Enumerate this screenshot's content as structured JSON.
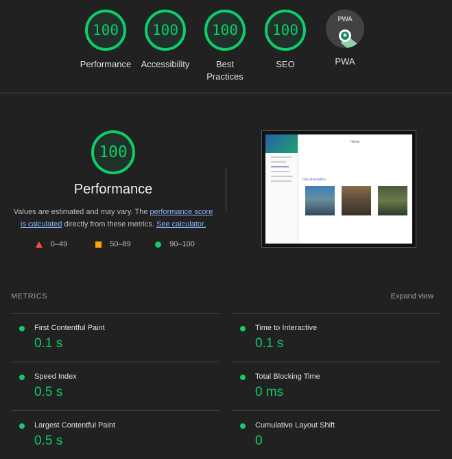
{
  "gauges": [
    {
      "label": "Performance",
      "score": "100"
    },
    {
      "label": "Accessibility",
      "score": "100"
    },
    {
      "label": "Best Practices",
      "score": "100"
    },
    {
      "label": "SEO",
      "score": "100"
    },
    {
      "label": "PWA",
      "badge_text": "PWA",
      "icon": "pwa-badge-icon"
    }
  ],
  "performance": {
    "score": "100",
    "title": "Performance",
    "desc_prefix": "Values are estimated and may vary. The ",
    "link_score": "performance score is calculated",
    "desc_middle": " directly from these metrics. ",
    "link_calculator": "See calculator.",
    "legend": [
      {
        "shape": "triangle",
        "range": "0–49",
        "color": "#ff4e42"
      },
      {
        "shape": "square",
        "range": "50–89",
        "color": "#ffa400"
      },
      {
        "shape": "circle",
        "range": "90–100",
        "color": "#0cce6b"
      }
    ]
  },
  "screenshot": {
    "page_title": "Home",
    "section_heading": "Documentation"
  },
  "metrics": {
    "heading": "METRICS",
    "expand_label": "Expand view",
    "items": [
      {
        "name": "First Contentful Paint",
        "value": "0.1 s",
        "status": "pass"
      },
      {
        "name": "Time to Interactive",
        "value": "0.1 s",
        "status": "pass"
      },
      {
        "name": "Speed Index",
        "value": "0.5 s",
        "status": "pass"
      },
      {
        "name": "Total Blocking Time",
        "value": "0 ms",
        "status": "pass"
      },
      {
        "name": "Largest Contentful Paint",
        "value": "0.5 s",
        "status": "pass"
      },
      {
        "name": "Cumulative Layout Shift",
        "value": "0",
        "status": "pass"
      }
    ]
  },
  "colors": {
    "pass": "#0cce6b",
    "average": "#ffa400",
    "fail": "#ff4e42",
    "link": "#8ab4f8"
  }
}
